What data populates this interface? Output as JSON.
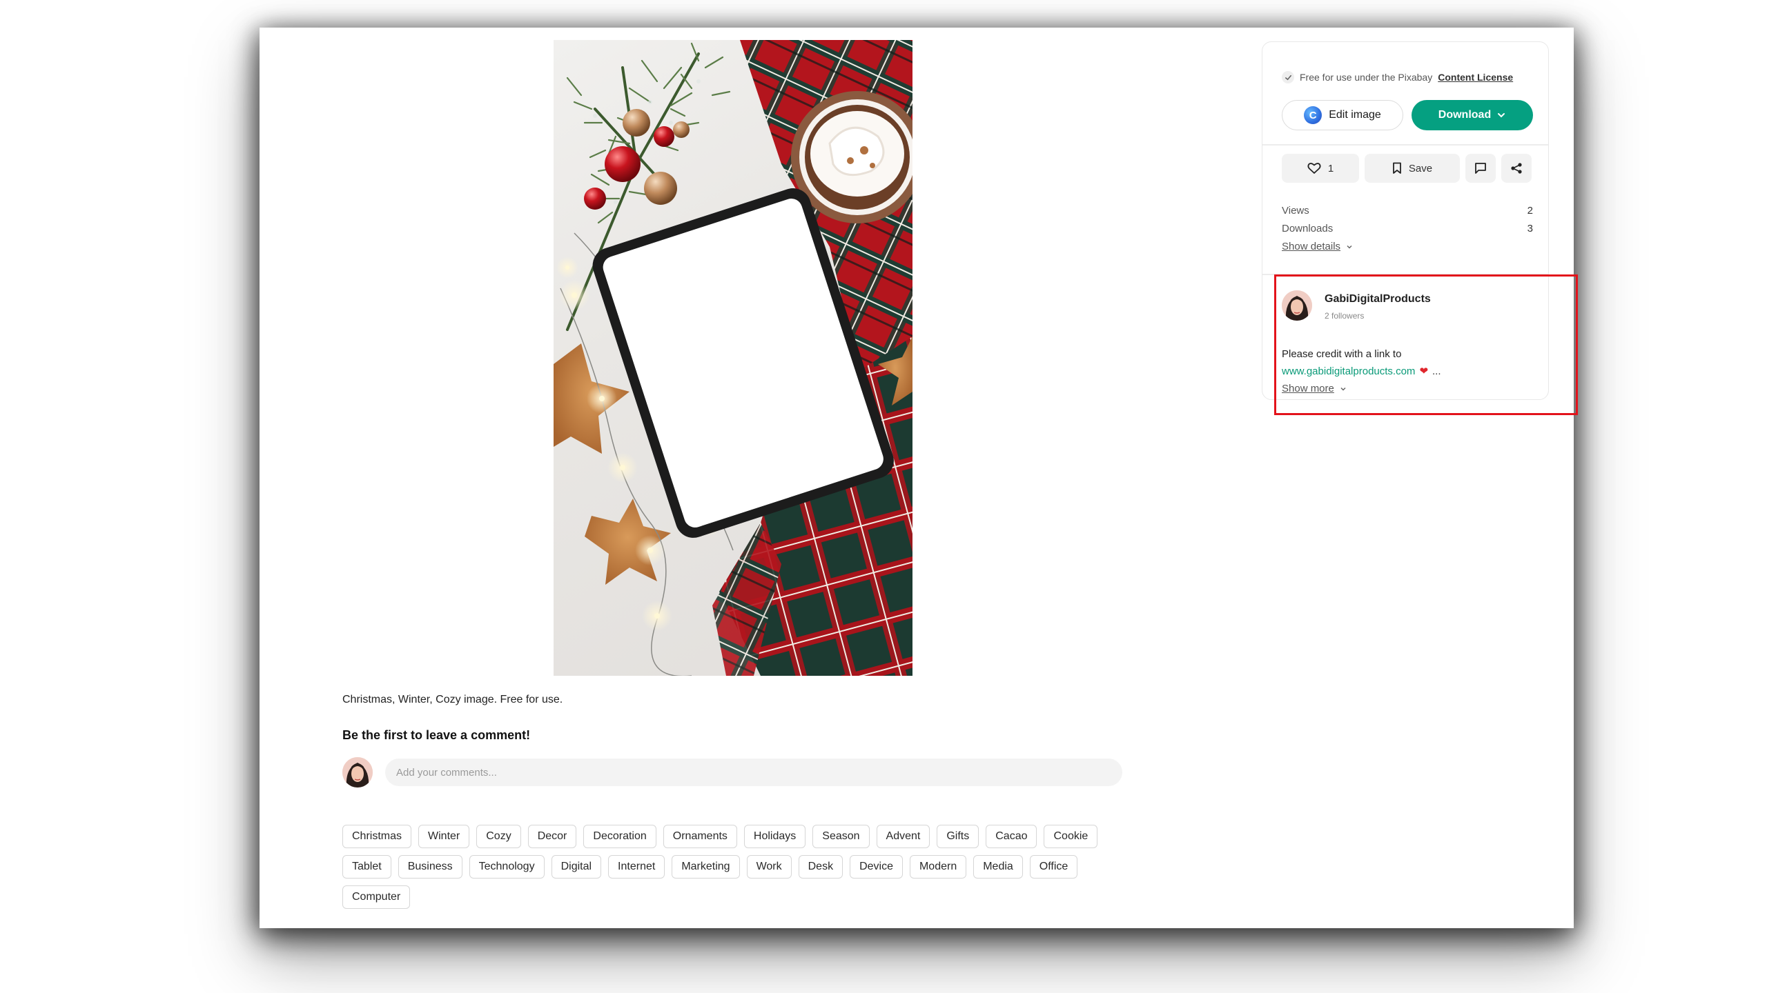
{
  "license": {
    "prefix": "Free for use under the Pixabay",
    "link": "Content License"
  },
  "buttons": {
    "edit_image": "Edit image",
    "edit_logo_letter": "C",
    "download": "Download",
    "like_count": "1",
    "save": "Save"
  },
  "stats": {
    "views_label": "Views",
    "views_value": "2",
    "downloads_label": "Downloads",
    "downloads_value": "3",
    "show_details": "Show details"
  },
  "user": {
    "name": "GabiDigitalProducts",
    "followers": "2 followers",
    "credit_text": "Please credit with a link to",
    "credit_link": "www.gabidigitalproducts.com",
    "ellipsis": "...",
    "show_more": "Show more"
  },
  "caption": "Christmas, Winter, Cozy image. Free for use.",
  "comments": {
    "heading": "Be the first to leave a comment!",
    "placeholder": "Add your comments..."
  },
  "tags": [
    "Christmas",
    "Winter",
    "Cozy",
    "Decor",
    "Decoration",
    "Ornaments",
    "Holidays",
    "Season",
    "Advent",
    "Gifts",
    "Cacao",
    "Cookie",
    "Tablet",
    "Business",
    "Technology",
    "Digital",
    "Internet",
    "Marketing",
    "Work",
    "Desk",
    "Device",
    "Modern",
    "Media",
    "Office",
    "Computer"
  ],
  "colors": {
    "download_button": "#05a081",
    "credit_link": "#0a9a78",
    "highlight_box": "#e3131b"
  },
  "icons": {
    "license_check": "check-icon",
    "download_chevron": "chevron-down-icon",
    "like": "heart-outline-icon",
    "save": "bookmark-icon",
    "comment": "comment-icon",
    "share": "share-icon",
    "credit_heart": "heart-icon"
  }
}
